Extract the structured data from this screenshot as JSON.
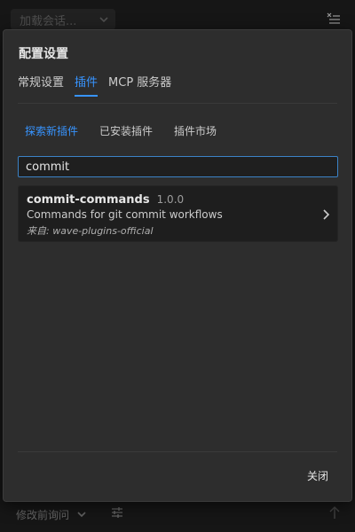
{
  "background": {
    "session_select": {
      "placeholder": "加载会话..."
    },
    "bottom": {
      "mode_label": "修改前询问"
    }
  },
  "modal": {
    "title": "配置设置",
    "main_tabs": [
      {
        "label": "常规设置",
        "active": false
      },
      {
        "label": "插件",
        "active": true
      },
      {
        "label": "MCP 服务器",
        "active": false
      }
    ],
    "sub_tabs": [
      {
        "label": "探索新插件",
        "active": true
      },
      {
        "label": "已安装插件",
        "active": false
      },
      {
        "label": "插件市场",
        "active": false
      }
    ],
    "search": {
      "value": "commit",
      "placeholder": ""
    },
    "results": [
      {
        "name": "commit-commands",
        "version": "1.0.0",
        "description": "Commands for git commit workflows",
        "source": "来自: wave-plugins-official"
      }
    ],
    "close_label": "关闭"
  },
  "colors": {
    "accent": "#3794ff",
    "modal_bg": "#2d2d2d",
    "page_bg": "#1e1e1e"
  }
}
